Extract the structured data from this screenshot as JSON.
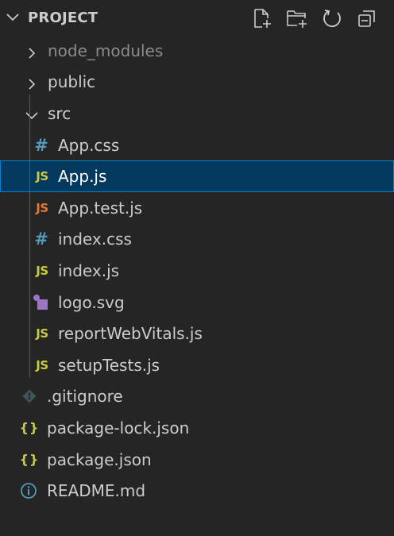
{
  "header": {
    "title": "PROJECT",
    "actions": [
      {
        "name": "new-file",
        "icon": "new-file-icon"
      },
      {
        "name": "new-folder",
        "icon": "new-folder-icon"
      },
      {
        "name": "refresh",
        "icon": "refresh-icon"
      },
      {
        "name": "collapse-all",
        "icon": "collapse-all-icon"
      }
    ]
  },
  "colors": {
    "background": "#252526",
    "selected_background": "#04395e",
    "selected_border": "#007fd4",
    "js_icon": "#cbcb41",
    "test_icon": "#e37933",
    "css_icon": "#519aba",
    "svg_icon": "#a074c4",
    "info_icon": "#519aba"
  },
  "tree": {
    "node_modules": {
      "label": "node_modules",
      "expanded": false
    },
    "public": {
      "label": "public",
      "expanded": false
    },
    "src": {
      "label": "src",
      "expanded": true
    },
    "src_files": {
      "app_css": {
        "label": "App.css",
        "icon": "#"
      },
      "app_js": {
        "label": "App.js",
        "icon": "JS",
        "selected": true
      },
      "app_test_js": {
        "label": "App.test.js",
        "icon": "JS"
      },
      "index_css": {
        "label": "index.css",
        "icon": "#"
      },
      "index_js": {
        "label": "index.js",
        "icon": "JS"
      },
      "logo_svg": {
        "label": "logo.svg",
        "icon": "svg-file-icon"
      },
      "report_web_vitals_js": {
        "label": "reportWebVitals.js",
        "icon": "JS"
      },
      "setup_tests_js": {
        "label": "setupTests.js",
        "icon": "JS"
      }
    },
    "root_files": {
      "gitignore": {
        "label": ".gitignore",
        "icon": "git-icon"
      },
      "package_lock_json": {
        "label": "package-lock.json",
        "icon": "{}"
      },
      "package_json": {
        "label": "package.json",
        "icon": "{}"
      },
      "readme_md": {
        "label": "README.md",
        "icon": "info-icon"
      }
    }
  }
}
